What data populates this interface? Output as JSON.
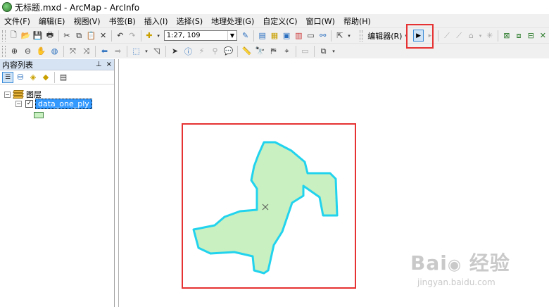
{
  "window": {
    "title": "无标题.mxd - ArcMap - ArcInfo"
  },
  "menu": [
    "文件(F)",
    "编辑(E)",
    "视图(V)",
    "书签(B)",
    "插入(I)",
    "选择(S)",
    "地理处理(G)",
    "自定义(C)",
    "窗口(W)",
    "帮助(H)"
  ],
  "toolbar": {
    "scale_value": "1:27, 109",
    "editor_label": "编辑器(R)",
    "edit_tool_selected": true
  },
  "toc": {
    "title": "内容列表",
    "pin_glyph": "ᅳ",
    "close_glyph": "×",
    "root_label": "图层",
    "layer_name": "data_one_ply",
    "layer_checked": true,
    "legend_fill": "#c9f0c0"
  },
  "map": {
    "polygon_fill": "#c9f0c0",
    "polygon_outline": "#22d3ee",
    "highlight_color": "#e63232"
  },
  "watermark": {
    "logo": "Bai 经验",
    "url": "jingyan.baidu.com"
  }
}
